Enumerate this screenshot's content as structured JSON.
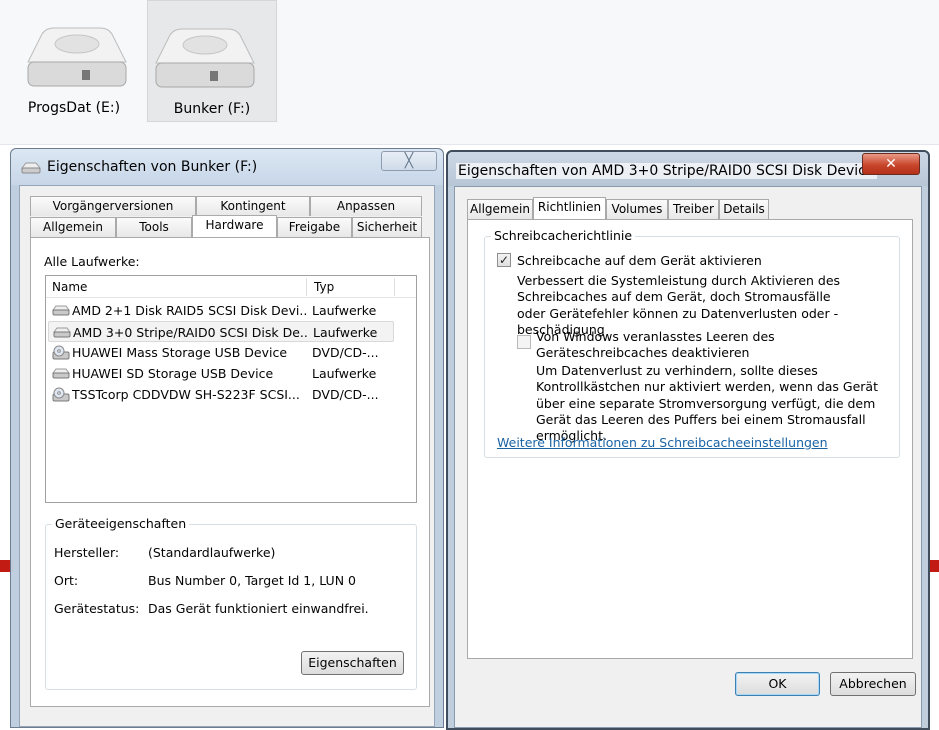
{
  "explorer": {
    "drives": [
      {
        "label": "ProgsDat (E:)",
        "icon": "hard-drive-icon"
      },
      {
        "label": "Bunker (F:)",
        "icon": "hard-drive-icon"
      }
    ]
  },
  "props_window": {
    "title": "Eigenschaften von Bunker (F:)",
    "close_label": "╳",
    "tabs_row1": [
      "Vorgängerversionen",
      "Kontingent",
      "Anpassen"
    ],
    "tabs_row2": [
      "Allgemein",
      "Tools",
      "Hardware",
      "Freigabe",
      "Sicherheit"
    ],
    "active_tab": "Hardware",
    "all_drives_label": "Alle Laufwerke:",
    "columns": {
      "name": "Name",
      "type": "Typ"
    },
    "drives": [
      {
        "name": "AMD 2+1 Disk RAID5 SCSI Disk Devi...",
        "type": "Laufwerke",
        "icon": "disk-drive-icon"
      },
      {
        "name": "AMD 3+0 Stripe/RAID0 SCSI Disk De...",
        "type": "Laufwerke",
        "icon": "disk-drive-icon"
      },
      {
        "name": "HUAWEI Mass Storage USB Device",
        "type": "DVD/CD-...",
        "icon": "cd-drive-icon"
      },
      {
        "name": "HUAWEI SD Storage USB Device",
        "type": "Laufwerke",
        "icon": "disk-drive-icon"
      },
      {
        "name": "TSSTcorp CDDVDW SH-S223F SCSI...",
        "type": "DVD/CD-...",
        "icon": "cd-drive-icon"
      }
    ],
    "selected_index": 1,
    "device_props": {
      "legend": "Geräteeigenschaften",
      "manufacturer_label": "Hersteller:",
      "manufacturer": "(Standardlaufwerke)",
      "location_label": "Ort:",
      "location": "Bus Number 0, Target Id 1, LUN 0",
      "status_label": "Gerätestatus:",
      "status": "Das Gerät funktioniert einwandfrei."
    },
    "properties_button": "Eigenschaften"
  },
  "device_window": {
    "title": "Eigenschaften von AMD 3+0 Stripe/RAID0 SCSI Disk Device",
    "close_label": "✕",
    "tabs": [
      "Allgemein",
      "Richtlinien",
      "Volumes",
      "Treiber",
      "Details"
    ],
    "active_tab": "Richtlinien",
    "policy_group": "Schreibcacherichtlinie",
    "enable_cache_label": "Schreibcache auf dem Gerät aktivieren",
    "enable_cache_checked": true,
    "enable_cache_desc": "Verbessert die Systemleistung durch Aktivieren des Schreibcaches auf dem Gerät, doch Stromausfälle oder Gerätefehler können zu Datenverlusten oder -beschädigung",
    "flush_label": "Von Windows veranlasstes Leeren des Geräteschreibcaches deaktivieren",
    "flush_checked": false,
    "flush_desc": "Um Datenverlust zu verhindern, sollte dieses Kontrollkästchen nur aktiviert werden, wenn das Gerät über eine separate Stromversorgung verfügt, die dem Gerät das Leeren des Puffers bei einem Stromausfall ermöglicht.",
    "more_info_link": "Weitere Informationen zu Schreibcacheeinstellungen",
    "ok_button": "OK",
    "cancel_button": "Abbrechen"
  },
  "colors": {
    "close_red": "#c8462c",
    "link_blue": "#1a63a5",
    "title_bar": "#c6d6e8"
  }
}
